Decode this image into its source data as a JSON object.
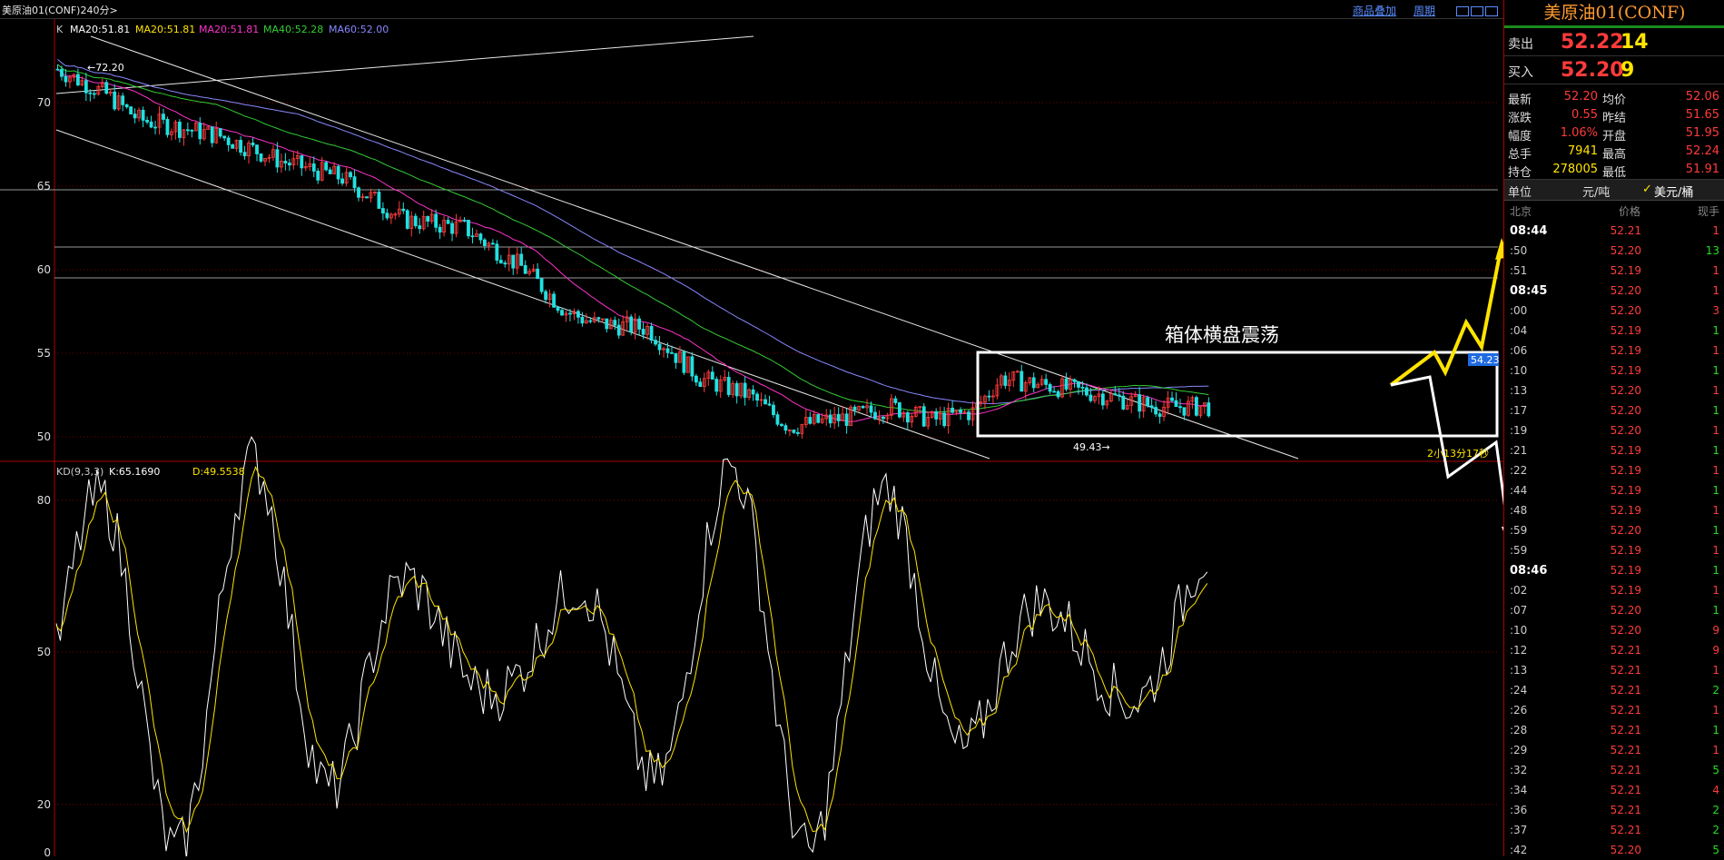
{
  "topbar": {
    "title": "美原油01(CONF)240分>",
    "links": [
      "商品叠加",
      "周期"
    ]
  },
  "main_chart": {
    "legend": {
      "k": "K",
      "ma1": "MA20:51.81",
      "ma2": "MA20:51.81",
      "ma3": "MA20:51.81",
      "ma4": "MA40:52.28",
      "ma5": "MA60:52.00"
    },
    "legend_colors": {
      "k": "#cccccc",
      "ma1": "#ffffff",
      "ma2": "#ffe400",
      "ma3": "#ff33cc",
      "ma4": "#33cc33",
      "ma5": "#8888ff"
    },
    "y_ticks": [
      "70",
      "65",
      "60",
      "55",
      "50"
    ],
    "high_label": "←72.20",
    "low_label": "49.43→",
    "annotation": "箱体横盘震荡",
    "price_tag": "54.23",
    "countdown": "2小13分17秒"
  },
  "kd_chart": {
    "legend": {
      "name": "KD(9,3,3)",
      "k": "K:65.1690",
      "d": "D:49.5538"
    },
    "y_ticks": [
      "80",
      "50",
      "20",
      "0"
    ]
  },
  "panel": {
    "title": "美原油01(CONF)",
    "sell_label": "卖出",
    "sell_price": "52.22",
    "sell_vol": "14",
    "buy_label": "买入",
    "buy_price": "52.20",
    "buy_vol": "9",
    "stats": [
      [
        "最新",
        "52.20",
        "均价",
        "52.06"
      ],
      [
        "涨跌",
        "0.55",
        "昨结",
        "51.65"
      ],
      [
        "幅度",
        "1.06%",
        "开盘",
        "51.95"
      ],
      [
        "总手",
        "7941",
        "最高",
        "52.24"
      ],
      [
        "持仓",
        "278005",
        "最低",
        "51.91"
      ]
    ],
    "unit_label": "单位",
    "unit_a": "元/吨",
    "unit_b": "美元/桶",
    "unit_check": "✓",
    "headers": [
      "北京",
      "价格",
      "现手"
    ],
    "ticks": [
      {
        "t": "08:44",
        "p": "52.21",
        "v": "1",
        "bold": true
      },
      {
        "t": ":50",
        "p": "52.20",
        "v": "13"
      },
      {
        "t": ":51",
        "p": "52.19",
        "v": "1"
      },
      {
        "t": "08:45",
        "p": "52.20",
        "v": "1",
        "bold": true
      },
      {
        "t": ":00",
        "p": "52.20",
        "v": "3"
      },
      {
        "t": ":04",
        "p": "52.19",
        "v": "1"
      },
      {
        "t": ":06",
        "p": "52.19",
        "v": "1"
      },
      {
        "t": ":10",
        "p": "52.19",
        "v": "1"
      },
      {
        "t": ":13",
        "p": "52.20",
        "v": "1"
      },
      {
        "t": ":17",
        "p": "52.20",
        "v": "1"
      },
      {
        "t": ":19",
        "p": "52.20",
        "v": "1"
      },
      {
        "t": ":21",
        "p": "52.19",
        "v": "1"
      },
      {
        "t": ":22",
        "p": "52.19",
        "v": "1"
      },
      {
        "t": ":44",
        "p": "52.19",
        "v": "1"
      },
      {
        "t": ":48",
        "p": "52.19",
        "v": "1"
      },
      {
        "t": ":59",
        "p": "52.20",
        "v": "1"
      },
      {
        "t": ":59",
        "p": "52.19",
        "v": "1"
      },
      {
        "t": "08:46",
        "p": "52.19",
        "v": "1",
        "bold": true
      },
      {
        "t": ":02",
        "p": "52.19",
        "v": "1"
      },
      {
        "t": ":07",
        "p": "52.20",
        "v": "1"
      },
      {
        "t": ":10",
        "p": "52.20",
        "v": "9"
      },
      {
        "t": ":12",
        "p": "52.21",
        "v": "9"
      },
      {
        "t": ":13",
        "p": "52.21",
        "v": "1"
      },
      {
        "t": ":24",
        "p": "52.21",
        "v": "2"
      },
      {
        "t": ":26",
        "p": "52.21",
        "v": "1"
      },
      {
        "t": ":28",
        "p": "52.21",
        "v": "1"
      },
      {
        "t": ":29",
        "p": "52.21",
        "v": "1"
      },
      {
        "t": ":32",
        "p": "52.21",
        "v": "5"
      },
      {
        "t": ":34",
        "p": "52.21",
        "v": "4"
      },
      {
        "t": ":36",
        "p": "52.21",
        "v": "2"
      },
      {
        "t": ":37",
        "p": "52.21",
        "v": "2"
      },
      {
        "t": ":42",
        "p": "52.20",
        "v": "5"
      }
    ],
    "colors": {
      "up": "#ff3b3b",
      "down": "#22dd22",
      "yellow": "#ffe400"
    }
  }
}
